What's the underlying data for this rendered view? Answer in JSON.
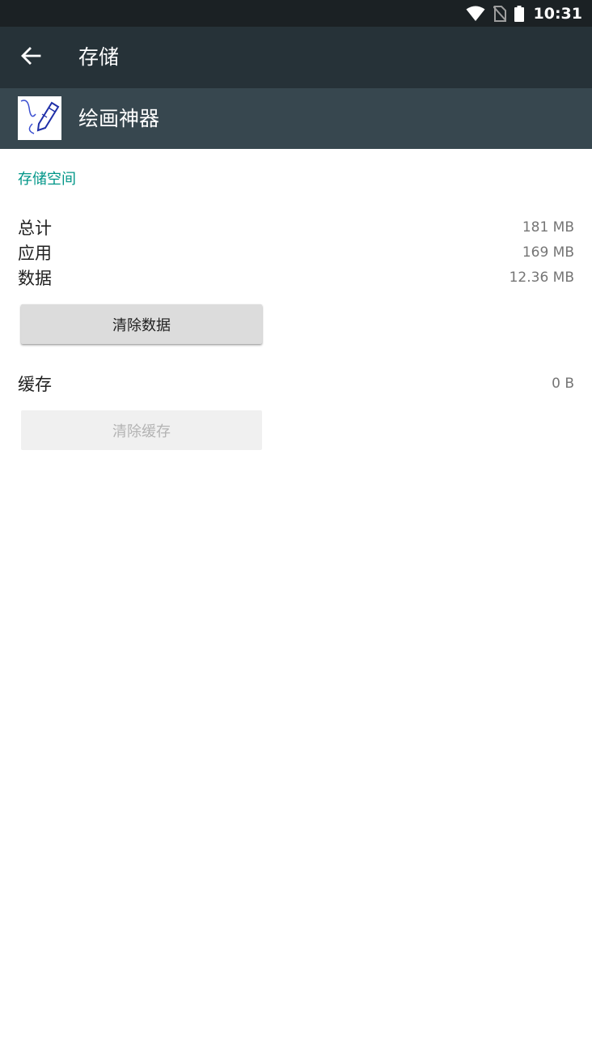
{
  "status_bar": {
    "time": "10:31",
    "icons": [
      "wifi-icon",
      "no-sim-icon",
      "battery-icon"
    ]
  },
  "toolbar": {
    "back_icon": "arrow-back-icon",
    "title": "存储"
  },
  "app_header": {
    "icon": "drawing-app-icon",
    "name": "绘画神器"
  },
  "storage": {
    "section_title": "存储空间",
    "rows": [
      {
        "label": "总计",
        "value": "181 MB"
      },
      {
        "label": "应用",
        "value": "169 MB"
      },
      {
        "label": "数据",
        "value": "12.36 MB"
      }
    ],
    "clear_data_label": "清除数据",
    "cache": {
      "label": "缓存",
      "value": "0 B"
    },
    "clear_cache_label": "清除缓存",
    "clear_cache_enabled": false
  },
  "colors": {
    "status_bar_bg": "#1b2124",
    "toolbar_bg": "#263238",
    "app_header_bg": "#37474f",
    "accent": "#009688"
  }
}
